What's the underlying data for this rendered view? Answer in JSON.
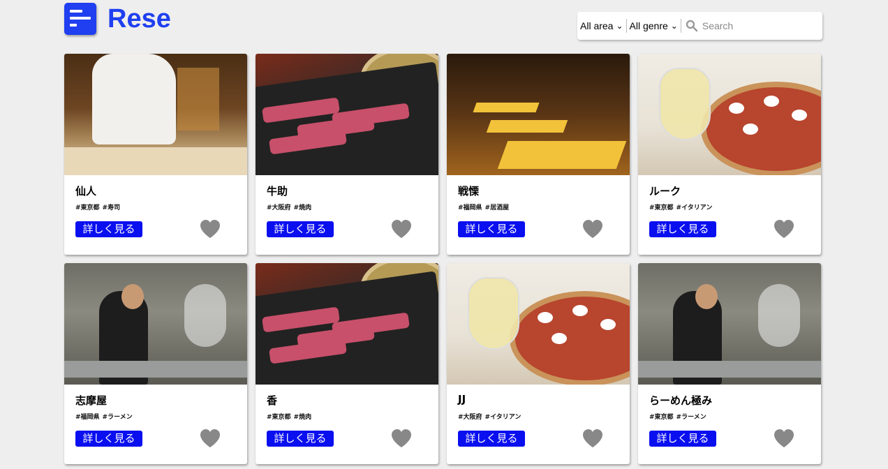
{
  "app": {
    "title": "Rese"
  },
  "search": {
    "area_selected": "All area",
    "genre_selected": "All genre",
    "placeholder": "Search"
  },
  "colors": {
    "brand": "#1f3ff0",
    "button": "#0a0ff0",
    "heart": "#888888"
  },
  "detail_label": "詳しく見る",
  "shops": [
    {
      "name": "仙人",
      "area": "#東京都",
      "genre": "#寿司",
      "image": "sushi"
    },
    {
      "name": "牛助",
      "area": "#大阪府",
      "genre": "#焼肉",
      "image": "yakiniku"
    },
    {
      "name": "戦慄",
      "area": "#福岡県",
      "genre": "#居酒屋",
      "image": "izakaya"
    },
    {
      "name": "ルーク",
      "area": "#東京都",
      "genre": "#イタリアン",
      "image": "italian"
    },
    {
      "name": "志摩屋",
      "area": "#福岡県",
      "genre": "#ラーメン",
      "image": "ramen"
    },
    {
      "name": "香",
      "area": "#東京都",
      "genre": "#焼肉",
      "image": "yakiniku"
    },
    {
      "name": "JJ",
      "area": "#大阪府",
      "genre": "#イタリアン",
      "image": "italian"
    },
    {
      "name": "らーめん極み",
      "area": "#東京都",
      "genre": "#ラーメン",
      "image": "ramen"
    }
  ]
}
